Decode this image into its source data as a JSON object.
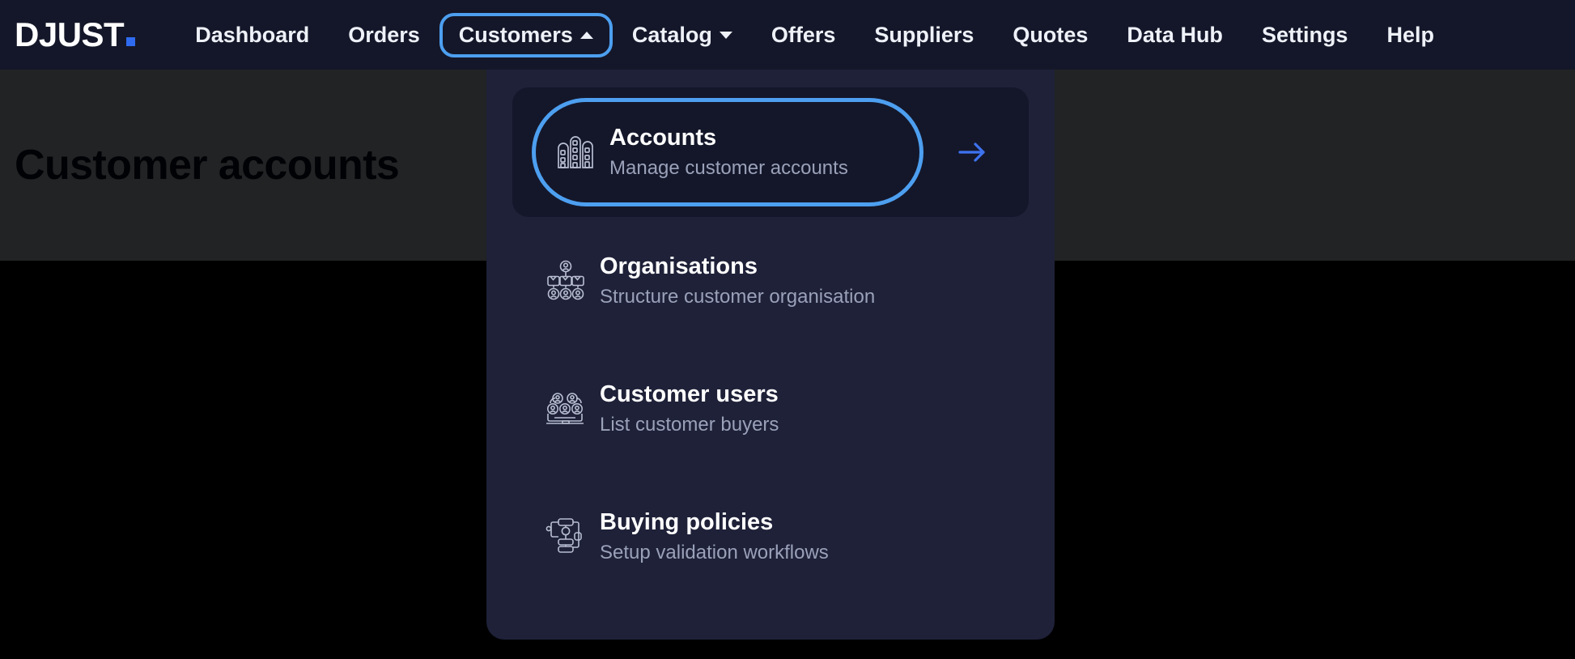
{
  "brand": {
    "logo_text": "DJUST",
    "logo_dot": "."
  },
  "topnav": {
    "items": [
      {
        "label": "Dashboard",
        "caret": "none",
        "state": "default"
      },
      {
        "label": "Orders",
        "caret": "none",
        "state": "default"
      },
      {
        "label": "Customers",
        "caret": "up",
        "state": "active-open"
      },
      {
        "label": "Catalog",
        "caret": "down",
        "state": "default"
      },
      {
        "label": "Offers",
        "caret": "none",
        "state": "default"
      },
      {
        "label": "Suppliers",
        "caret": "none",
        "state": "default"
      },
      {
        "label": "Quotes",
        "caret": "none",
        "state": "default"
      },
      {
        "label": "Data Hub",
        "caret": "none",
        "state": "default"
      },
      {
        "label": "Settings",
        "caret": "none",
        "state": "default"
      },
      {
        "label": "Help",
        "caret": "none",
        "state": "default"
      }
    ]
  },
  "page": {
    "title": "Customer accounts"
  },
  "dropdown": {
    "owner": "Customers",
    "items": [
      {
        "title": "Accounts",
        "subtitle": "Manage customer accounts",
        "icon": "buildings-icon",
        "highlighted": true,
        "arrow": "arrow-right-icon"
      },
      {
        "title": "Organisations",
        "subtitle": "Structure customer organisation",
        "icon": "org-chart-icon",
        "highlighted": false,
        "arrow": ""
      },
      {
        "title": "Customer users",
        "subtitle": "List customer buyers",
        "icon": "people-group-icon",
        "highlighted": false,
        "arrow": ""
      },
      {
        "title": "Buying policies",
        "subtitle": "Setup validation workflows",
        "icon": "workflow-icon",
        "highlighted": false,
        "arrow": ""
      }
    ]
  },
  "colors": {
    "nav_background": "#141729",
    "dropdown_background": "#1e2138",
    "card_background": "#14172a",
    "accent_focus": "#4d9ff0",
    "accent_arrow": "#3d73f0",
    "accent_logo_dot": "#2f6bf0",
    "page_band": "#f2f5fd",
    "page_title": "#0d1326",
    "subtitle_text": "#9aa1b9"
  }
}
